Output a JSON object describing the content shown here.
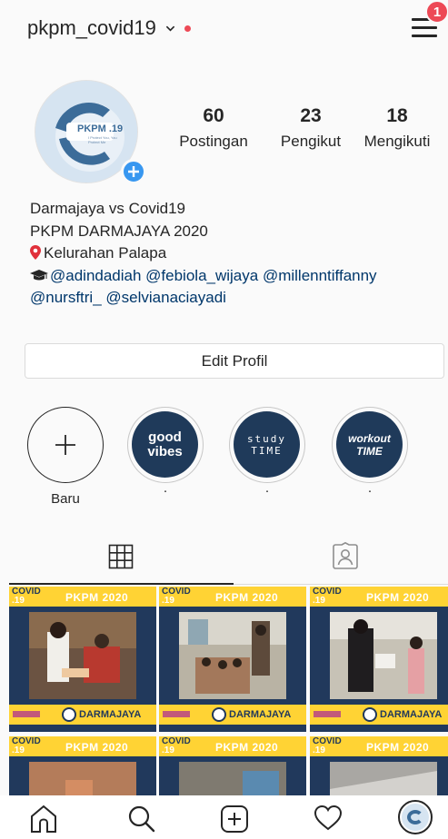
{
  "header": {
    "username": "pkpm_covid19",
    "notification_count": "1",
    "icons": [
      "chevron-down-icon",
      "hamburger-menu-icon"
    ]
  },
  "profile": {
    "avatar_text": "PKPM .19",
    "avatar_subtext": "I Protect You, You Protect Me",
    "stats": [
      {
        "value": "60",
        "label": "Postingan"
      },
      {
        "value": "23",
        "label": "Pengikut"
      },
      {
        "value": "18",
        "label": "Mengikuti"
      }
    ],
    "bio": {
      "line1": "Darmajaya vs Covid19",
      "line2": "PKPM DARMAJAYA 2020",
      "location": "Kelurahan Palapa",
      "mentions_line1": "@adindadiah @febiola_wijaya @millenntiffanny",
      "mentions_line2": "@nursftri_ @selvianaciayadi"
    },
    "edit_button": "Edit Profil"
  },
  "highlights": [
    {
      "label": "Baru",
      "cover": ""
    },
    {
      "label": "·",
      "cover": "good vibes"
    },
    {
      "label": "·",
      "cover": "study TIME"
    },
    {
      "label": "·",
      "cover": "workout TIME"
    }
  ],
  "tabs": [
    "grid-icon",
    "tagged-icon"
  ],
  "posts": {
    "banner_top_left": "COVID",
    "banner_top_num": ".19",
    "banner_title": "PKPM 2020",
    "banner_bottom": "DARMAJAYA",
    "ig_tag": "pkpm_covid19"
  },
  "bottom_nav": [
    "home-icon",
    "search-icon",
    "new-post-icon",
    "activity-heart-icon",
    "profile-avatar-icon"
  ],
  "colors": {
    "accent_blue": "#3897f0",
    "notif_red": "#ed4956",
    "mention_blue": "#00376b",
    "post_navy": "#21395c",
    "post_yellow": "#ffd334"
  }
}
